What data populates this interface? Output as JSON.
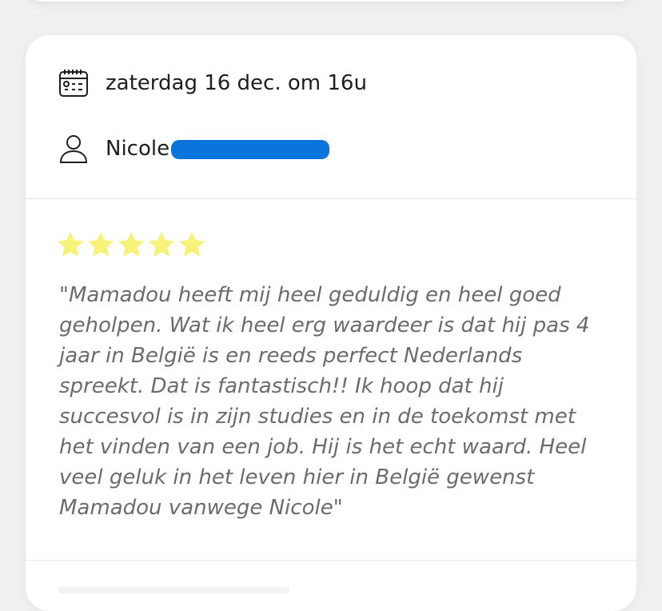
{
  "appointment": {
    "date_text": "zaterdag 16 dec. om 16u",
    "person_name": "Nicole"
  },
  "review": {
    "rating": 5,
    "max_rating": 5,
    "star_color": "#f7f27a",
    "text": "\"Mamadou heeft mij heel geduldig en heel goed geholpen. Wat ik heel erg waardeer is dat hij pas 4 jaar in België is en reeds perfect Nederlands spreekt. Dat is fantastisch!! Ik hoop dat hij succesvol is in zijn studies en in de toekomst met het vinden van een job. Hij is het echt waard. Heel veel geluk in het leven hier in België gewenst Mamadou vanwege Nicole\""
  },
  "icons": {
    "date": "calendar-icon",
    "person": "user-icon",
    "star": "star-icon"
  },
  "colors": {
    "redaction": "#0a74da",
    "card_bg": "#ffffff",
    "page_bg": "#f0f0f0"
  }
}
